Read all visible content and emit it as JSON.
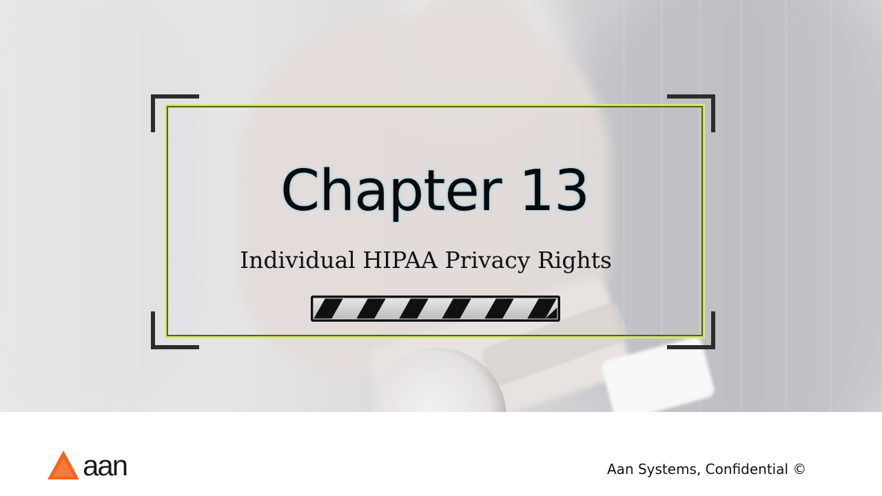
{
  "slide": {
    "title": "Chapter 13",
    "subtitle": "Individual HIPAA Privacy Rights"
  },
  "footer": {
    "logo_text": "aan",
    "confidential": "Aan Systems, Confidential ©"
  },
  "colors": {
    "frame_accent": "#c8e05a",
    "corner_brackets": "#2c2c2c",
    "logo_orange": "#f26522"
  },
  "icons": {
    "logo_mark": "orange-triangle-logo",
    "progress_bar": "striped-bar-icon"
  }
}
